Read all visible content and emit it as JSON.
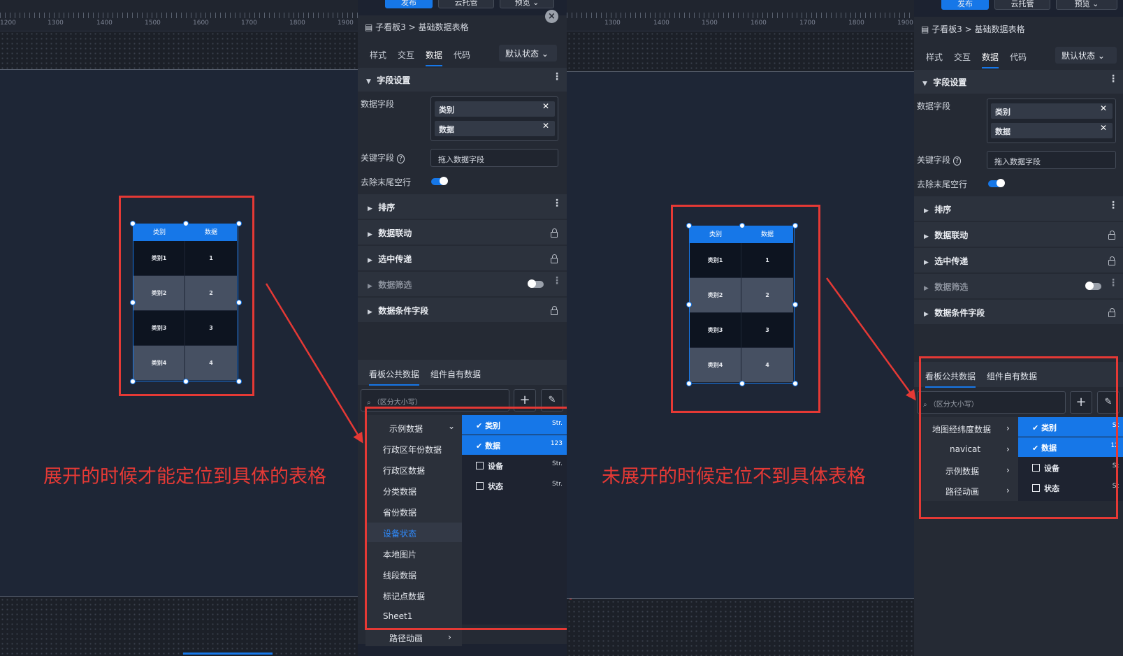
{
  "left": {
    "ruler_numbers": [
      "1200",
      "1300",
      "1400",
      "1500",
      "1600",
      "1700",
      "1800",
      "1900"
    ],
    "top_buttons": [
      "发布",
      "云托管",
      "预览"
    ],
    "breadcrumb": {
      "parent": "子看板3",
      "separator": ">",
      "current": "基础数据表格"
    },
    "tabs": [
      "样式",
      "交互",
      "数据",
      "代码"
    ],
    "active_tab": "数据",
    "state_select": "默认状态",
    "field_section": "字段设置",
    "data_field_label": "数据字段",
    "data_fields": [
      "类别",
      "数据"
    ],
    "key_field_label": "关键字段",
    "key_field_placeholder": "拖入数据字段",
    "trim_label": "去除末尾空行",
    "sections": [
      "排序",
      "数据联动",
      "选中传递",
      "数据筛选",
      "数据条件字段"
    ],
    "ds_tabs": [
      "看板公共数据",
      "组件自有数据"
    ],
    "search_placeholder": "（区分大小写）",
    "menu_items": [
      "示例数据",
      "行政区年份数据",
      "行政区数据",
      "分类数据",
      "省份数据",
      "设备状态",
      "本地图片",
      "线段数据",
      "标记点数据",
      "Sheet1",
      "路径动画"
    ],
    "menu_active": "设备状态",
    "sub_items": [
      {
        "name": "类别",
        "type": "Str.",
        "checked": true
      },
      {
        "name": "数据",
        "type": "123",
        "checked": true
      },
      {
        "name": "设备",
        "type": "Str.",
        "checked": false
      },
      {
        "name": "状态",
        "type": "Str.",
        "checked": false
      }
    ],
    "caption": "展开的时候才能定位到具体的表格"
  },
  "right": {
    "ruler_numbers": [
      "1300",
      "1400",
      "1500",
      "1600",
      "1700",
      "1800",
      "1900"
    ],
    "top_buttons": [
      "发布",
      "云托管",
      "预览"
    ],
    "breadcrumb": {
      "parent": "子看板3",
      "separator": ">",
      "current": "基础数据表格"
    },
    "tabs": [
      "样式",
      "交互",
      "数据",
      "代码"
    ],
    "active_tab": "数据",
    "state_select": "默认状态",
    "field_section": "字段设置",
    "data_field_label": "数据字段",
    "data_fields": [
      "类别",
      "数据"
    ],
    "key_field_label": "关键字段",
    "key_field_placeholder": "拖入数据字段",
    "trim_label": "去除末尾空行",
    "sections": [
      "排序",
      "数据联动",
      "选中传递",
      "数据筛选",
      "数据条件字段"
    ],
    "ds_tabs": [
      "看板公共数据",
      "组件自有数据"
    ],
    "search_placeholder": "（区分大小写）",
    "menu_items": [
      "地图经纬度数据",
      "navicat",
      "示例数据",
      "路径动画"
    ],
    "sub_items": [
      {
        "name": "类别",
        "type": "St",
        "checked": true
      },
      {
        "name": "数据",
        "type": "12",
        "checked": true
      },
      {
        "name": "设备",
        "type": "St",
        "checked": false
      },
      {
        "name": "状态",
        "type": "St",
        "checked": false
      }
    ],
    "caption": "未展开的时候定位不到具体表格"
  },
  "table": {
    "headers": [
      "类别",
      "数据"
    ],
    "rows": [
      [
        "类别1",
        "1"
      ],
      [
        "类别2",
        "2"
      ],
      [
        "类别3",
        "3"
      ],
      [
        "类别4",
        "4"
      ]
    ]
  },
  "colors": {
    "accent": "#1677e8",
    "annotation": "#e53935",
    "panel": "#252a34",
    "canvas": "#1e2636"
  }
}
